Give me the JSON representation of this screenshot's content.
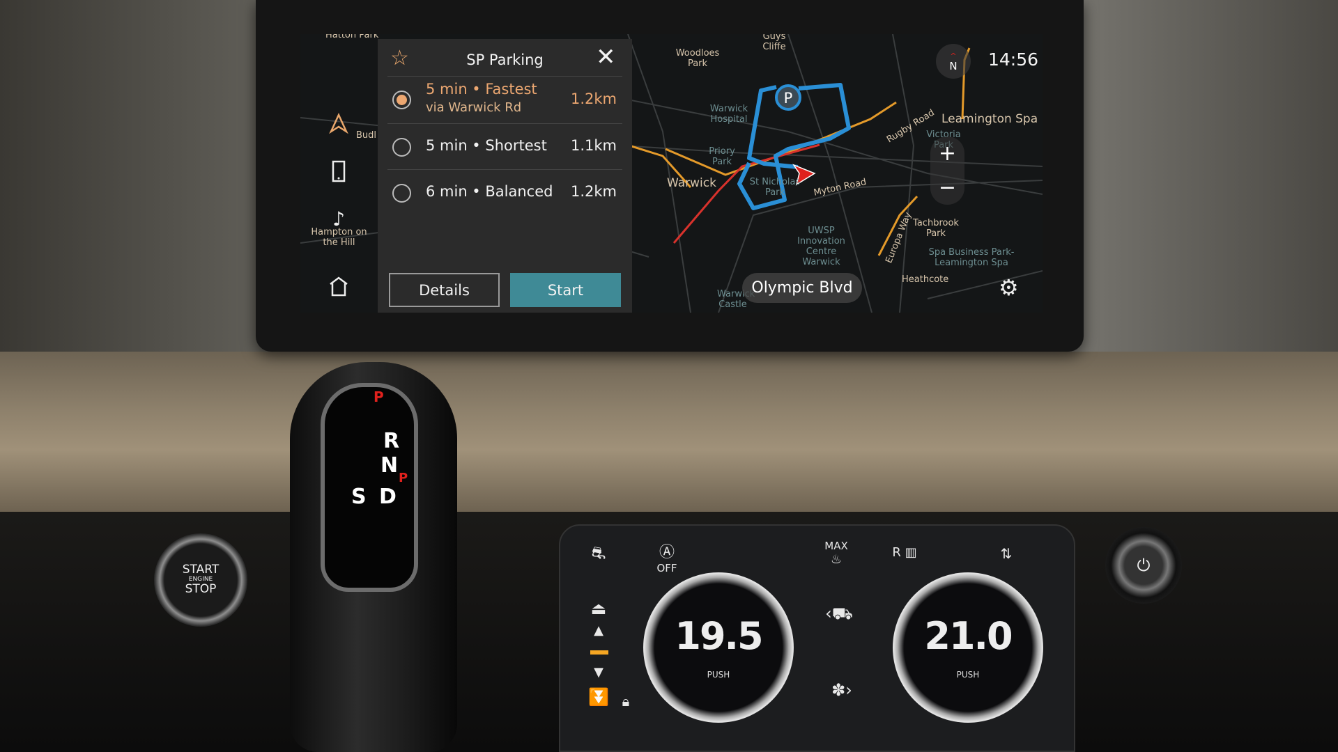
{
  "navigation_panel": {
    "title": "SP Parking",
    "favorite_icon": "star-icon",
    "close_icon": "close-icon",
    "routes": [
      {
        "label": "5 min • Fastest",
        "via": "via Warwick Rd",
        "distance": "1.2km",
        "selected": true
      },
      {
        "label": "5 min • Shortest",
        "distance": "1.1km",
        "selected": false
      },
      {
        "label": "6 min • Balanced",
        "distance": "1.2km",
        "selected": false
      }
    ],
    "details_label": "Details",
    "start_label": "Start"
  },
  "rail": {
    "icons": [
      "navigation-icon",
      "phone-icon",
      "music-icon",
      "home-icon"
    ]
  },
  "status": {
    "time": "14:56",
    "compass": "N"
  },
  "map": {
    "current_street": "Olympic Blvd",
    "parking_marker": "P",
    "labels": [
      "Hatton Park",
      "Budl",
      "Hampton on the Hill",
      "Guys Cliffe",
      "Woodloes Park",
      "Warwick Hospital",
      "Priory Park",
      "Warwick",
      "St Nicholas Park",
      "Myton Road",
      "Rugby Road",
      "Leamington Spa",
      "Victoria Park",
      "UWSP Innovation Centre Warwick",
      "Europa Way",
      "Tachbrook Park",
      "Spa Business Park-Leamington Spa",
      "Heathcote",
      "Warwick Castle"
    ],
    "colors": {
      "route": "#2a8fd6",
      "traffic_orange": "#e49a2a",
      "traffic_red": "#d8322c",
      "vehicle": "#e0211d"
    }
  },
  "colors": {
    "accent": "#eca771",
    "start_button": "#3f8a96"
  },
  "hardware": {
    "start_button": {
      "top": "START",
      "middle": "ENGINE",
      "bottom": "STOP"
    },
    "gear_positions": [
      "P",
      "R",
      "N",
      "D",
      "S"
    ],
    "gear_indicator": "P",
    "climate": {
      "left_temp": "19.5",
      "right_temp": "21.0",
      "push_label": "PUSH",
      "auto_off": "OFF",
      "max_label": "MAX",
      "rear_label": "R"
    }
  }
}
